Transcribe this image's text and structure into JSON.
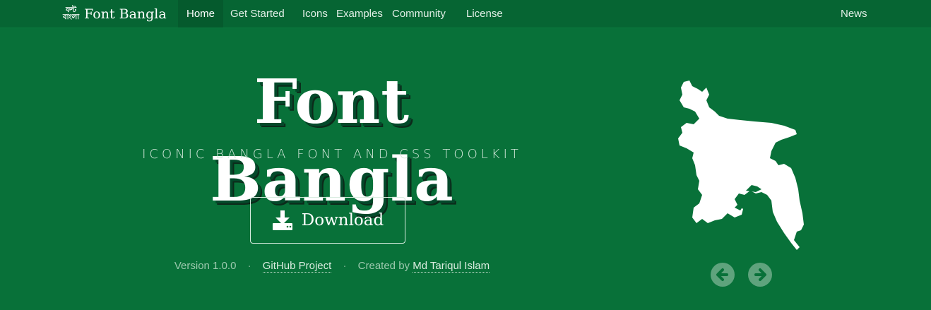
{
  "nav": {
    "brand_logo_line1": "ফন্ট",
    "brand_logo_line2": "বাংলা",
    "brand": "Font Bangla",
    "items": [
      {
        "label": "Home",
        "active": true
      },
      {
        "label": "Get Started"
      },
      {
        "label": "Icons"
      },
      {
        "label": "Examples"
      },
      {
        "label": "Community"
      },
      {
        "label": "License"
      }
    ],
    "news": "News"
  },
  "hero": {
    "title": "Font Bangla",
    "tagline": "ICONIC BANGLA FONT AND CSS TOOLKIT",
    "download_label": "Download",
    "version": "Version 1.0.0",
    "separator": "·",
    "github_label": "GitHub Project",
    "created_by": "Created by",
    "author": "Md Tariqul Islam"
  },
  "carousel": {
    "prev_icon": "arrow-left-circle-icon",
    "next_icon": "arrow-right-circle-icon"
  },
  "colors": {
    "background": "#087139",
    "navbar": "#066533",
    "active_nav": "#055a2d",
    "text": "#ffffff"
  }
}
